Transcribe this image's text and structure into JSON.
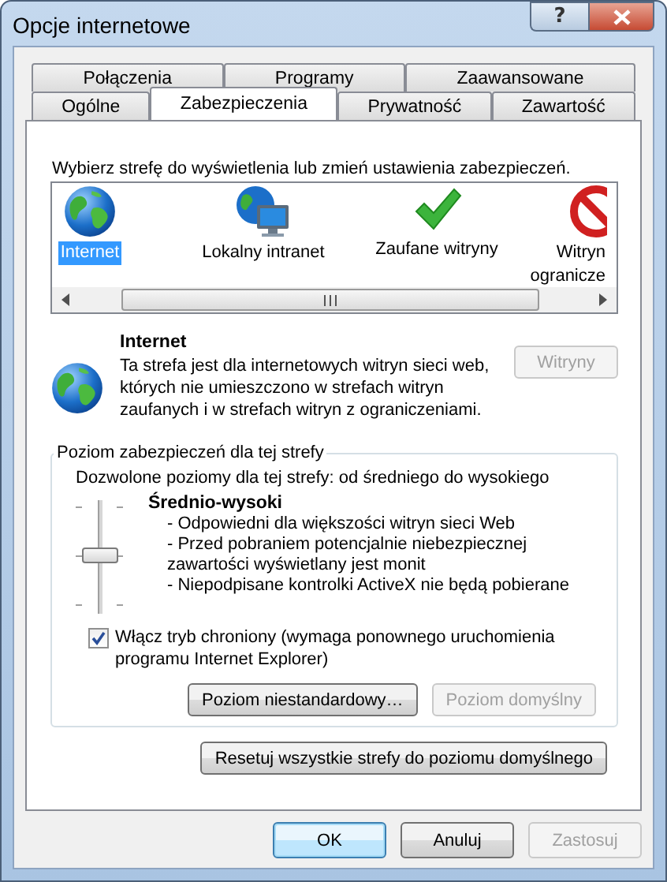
{
  "window": {
    "title": "Opcje internetowe",
    "help_label": "?"
  },
  "tab_rows": [
    [
      {
        "label": "Połączenia",
        "selected": false
      },
      {
        "label": "Programy",
        "selected": false
      },
      {
        "label": "Zaawansowane",
        "selected": false
      }
    ],
    [
      {
        "label": "Ogólne",
        "selected": false
      },
      {
        "label": "Zabezpieczenia",
        "selected": true
      },
      {
        "label": "Prywatność",
        "selected": false
      },
      {
        "label": "Zawartość",
        "selected": false
      }
    ]
  ],
  "zone_prompt": "Wybierz strefę do wyświetlenia lub zmień ustawienia zabezpieczeń.",
  "zones": [
    {
      "kind": "internet",
      "lines": [
        "Internet"
      ],
      "selected": true
    },
    {
      "kind": "intranet",
      "lines": [
        "Lokalny intranet"
      ],
      "selected": false
    },
    {
      "kind": "trusted",
      "lines": [
        "Zaufane witryny"
      ],
      "selected": false
    },
    {
      "kind": "restricted",
      "lines": [
        "Witryn",
        "ogranicze"
      ],
      "selected": false
    }
  ],
  "zone_info": {
    "kind": "internet",
    "title": "Internet",
    "description": "Ta strefa jest dla internetowych witryn sieci web, których nie umieszczono w strefach witryn zaufanych i w strefach witryn z ograniczeniami.",
    "sites_button": {
      "label": "Witryny",
      "disabled": true
    }
  },
  "security_level": {
    "group_title": "Poziom zabezpieczeń dla tej strefy",
    "allowed": "Dozwolone poziomy dla tej strefy: od średniego do wysokiego",
    "level": 0.5,
    "level_name": "Średnio-wysoki",
    "bullets": [
      "- Odpowiedni dla większości witryn sieci Web",
      "- Przed pobraniem potencjalnie niebezpiecznej zawartości wyświetlany jest monit",
      "- Niepodpisane kontrolki ActiveX nie będą pobierane"
    ],
    "protected_mode": {
      "label": "Włącz tryb chroniony (wymaga ponownego uruchomienia programu Internet Explorer)",
      "checked": true
    },
    "buttons": [
      {
        "label": "Poziom niestandardowy…",
        "disabled": false
      },
      {
        "label": "Poziom domyślny",
        "disabled": true
      }
    ]
  },
  "reset_button": {
    "label": "Resetuj wszystkie strefy do poziomu domyślnego",
    "disabled": false
  },
  "dialog_buttons": [
    {
      "label": "OK",
      "default": true,
      "disabled": false
    },
    {
      "label": "Anuluj",
      "default": false,
      "disabled": false
    },
    {
      "label": "Zastosuj",
      "default": false,
      "disabled": true
    }
  ]
}
